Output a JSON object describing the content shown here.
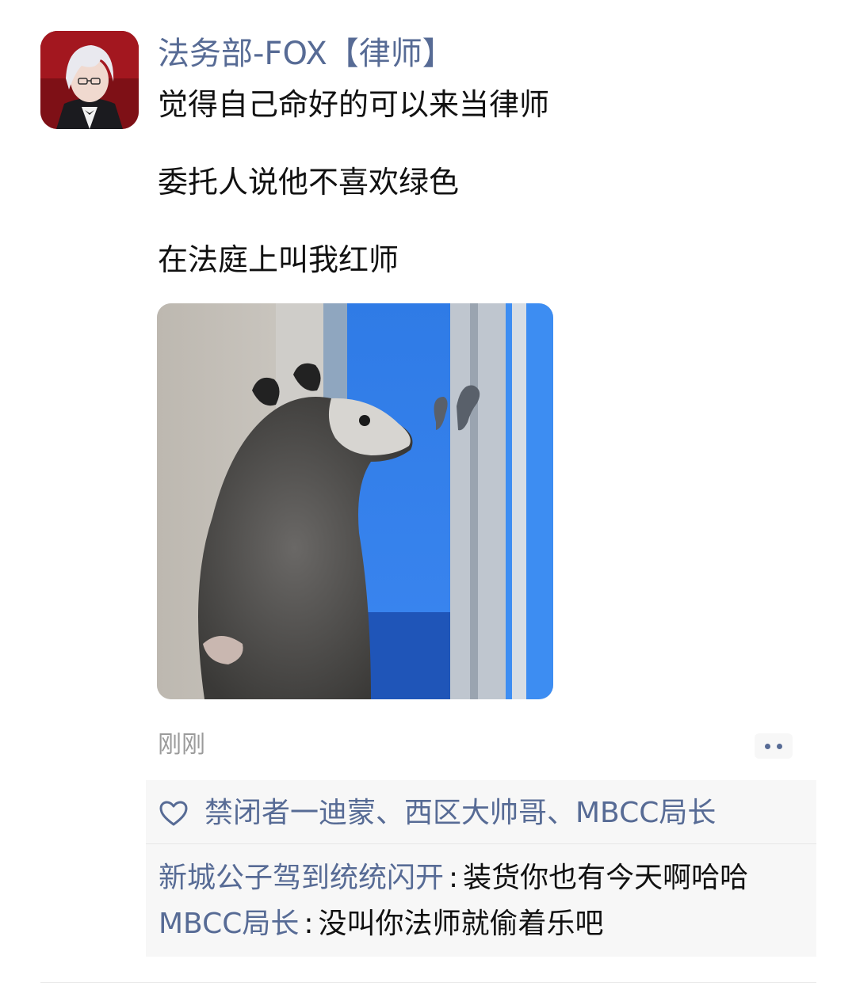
{
  "post": {
    "author": "法务部-FOX【律师】",
    "text_lines": [
      "觉得自己命好的可以来当律师",
      "委托人说他不喜欢绿色",
      "在法庭上叫我红师"
    ],
    "time": "刚刚"
  },
  "likes": {
    "names": "禁闭者一迪蒙、西区大帅哥、MBCC局长"
  },
  "comments": [
    {
      "author": "新城公子驾到统统闪开",
      "sep": ":",
      "text": "装货你也有今天啊哈哈"
    },
    {
      "author": "MBCC局长",
      "sep": ":",
      "text": "没叫你法师就偷着乐吧"
    }
  ],
  "icons": {
    "like": "heart-outline-icon",
    "more": "more-dots-icon"
  },
  "colors": {
    "link": "#576b95",
    "muted": "#9b9b9b",
    "panel": "#f7f7f7"
  }
}
